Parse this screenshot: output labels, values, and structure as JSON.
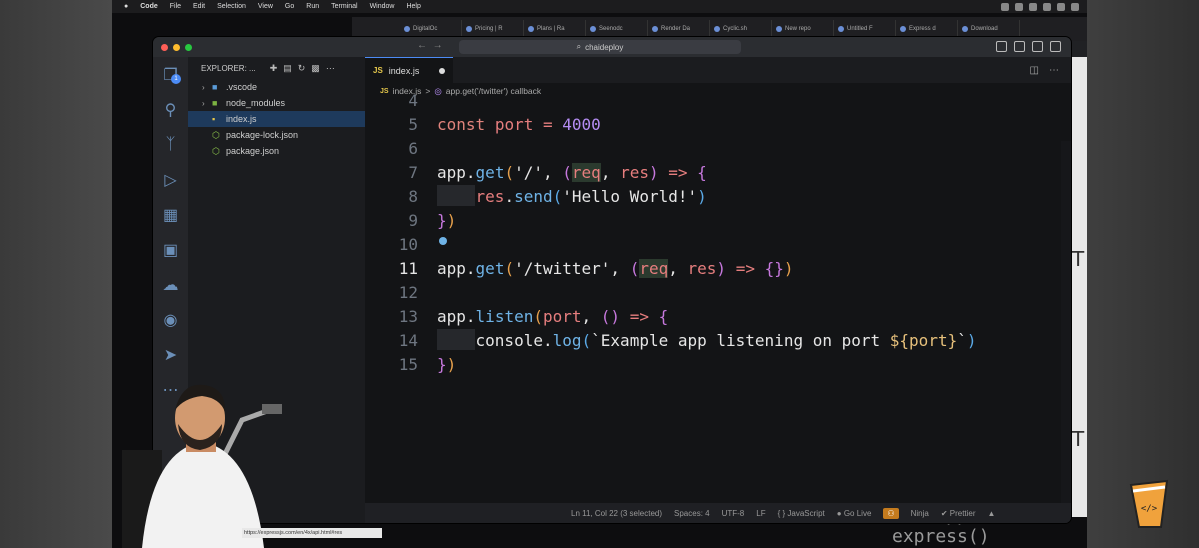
{
  "mac_menubar": {
    "apple": "",
    "app": "Code",
    "items": [
      "File",
      "Edit",
      "Selection",
      "View",
      "Go",
      "Run",
      "Terminal",
      "Window",
      "Help"
    ]
  },
  "browser": {
    "tabs": [
      "DigitalOc",
      "Pricing | R",
      "Plans | Ra",
      "Seenodc",
      "Render Da",
      "Cyclic.sh",
      "New repo",
      "Untitled F",
      "Express d",
      "Download"
    ],
    "side_glyphs": [
      "T",
      "T"
    ],
    "status_url": "https://expressjs.com/en/4x/api.html#res",
    "background_code": "var app = express()"
  },
  "vscode": {
    "command_center": "chaideploy",
    "nav_back": "←",
    "nav_forward": "→",
    "explorer_title": "EXPLORER: ...",
    "explorer_badge": "1",
    "tree": [
      {
        "label": ".vscode",
        "type": "folder",
        "chevron": "›"
      },
      {
        "label": "node_modules",
        "type": "folder",
        "chevron": "›"
      },
      {
        "label": "index.js",
        "type": "js",
        "selected": true
      },
      {
        "label": "package-lock.json",
        "type": "json"
      },
      {
        "label": "package.json",
        "type": "json"
      }
    ],
    "tab": {
      "label": "index.js",
      "icon": "JS",
      "modified": true
    },
    "breadcrumbs": {
      "file": "index.js",
      "separator": ">",
      "symbol": "app.get('/twitter') callback"
    },
    "line_numbers": [
      "4",
      "5",
      "6",
      "7",
      "8",
      "9",
      "10",
      "11",
      "12",
      "13",
      "14",
      "15"
    ],
    "code_lines": [
      "",
      "const port = 4000",
      "",
      "app.get('/', (req, res) => {",
      "    res.send('Hello World!')",
      "})",
      "",
      "app.get('/twitter', (req, res) => {})",
      "",
      "app.listen(port, () => {",
      "    console.log(`Example app listening on port ${port}`)",
      "})"
    ],
    "current_line": "11",
    "statusbar": {
      "position": "Ln 11, Col 22 (3 selected)",
      "spaces": "Spaces: 4",
      "encoding": "UTF-8",
      "eol": "LF",
      "language": "{ } JavaScript",
      "golive": "Go Live",
      "copilot": "⚇",
      "ninja": "Ninja",
      "prettier": "Prettier"
    }
  },
  "colors": {
    "accent_tab": "#4c8bf5",
    "keyword": "#e0837c",
    "number": "#b48cf2",
    "function": "#6fb3e6",
    "js_icon": "#e6c84c"
  }
}
